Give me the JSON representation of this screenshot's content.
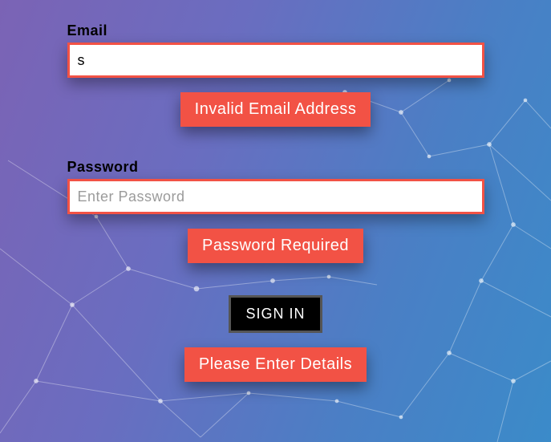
{
  "email": {
    "label": "Email",
    "value": "s",
    "error": "Invalid Email Address"
  },
  "password": {
    "label": "Password",
    "placeholder": "Enter Password",
    "value": "",
    "error": "Password Required"
  },
  "signin_label": "SIGN IN",
  "form_error": "Please Enter Details"
}
